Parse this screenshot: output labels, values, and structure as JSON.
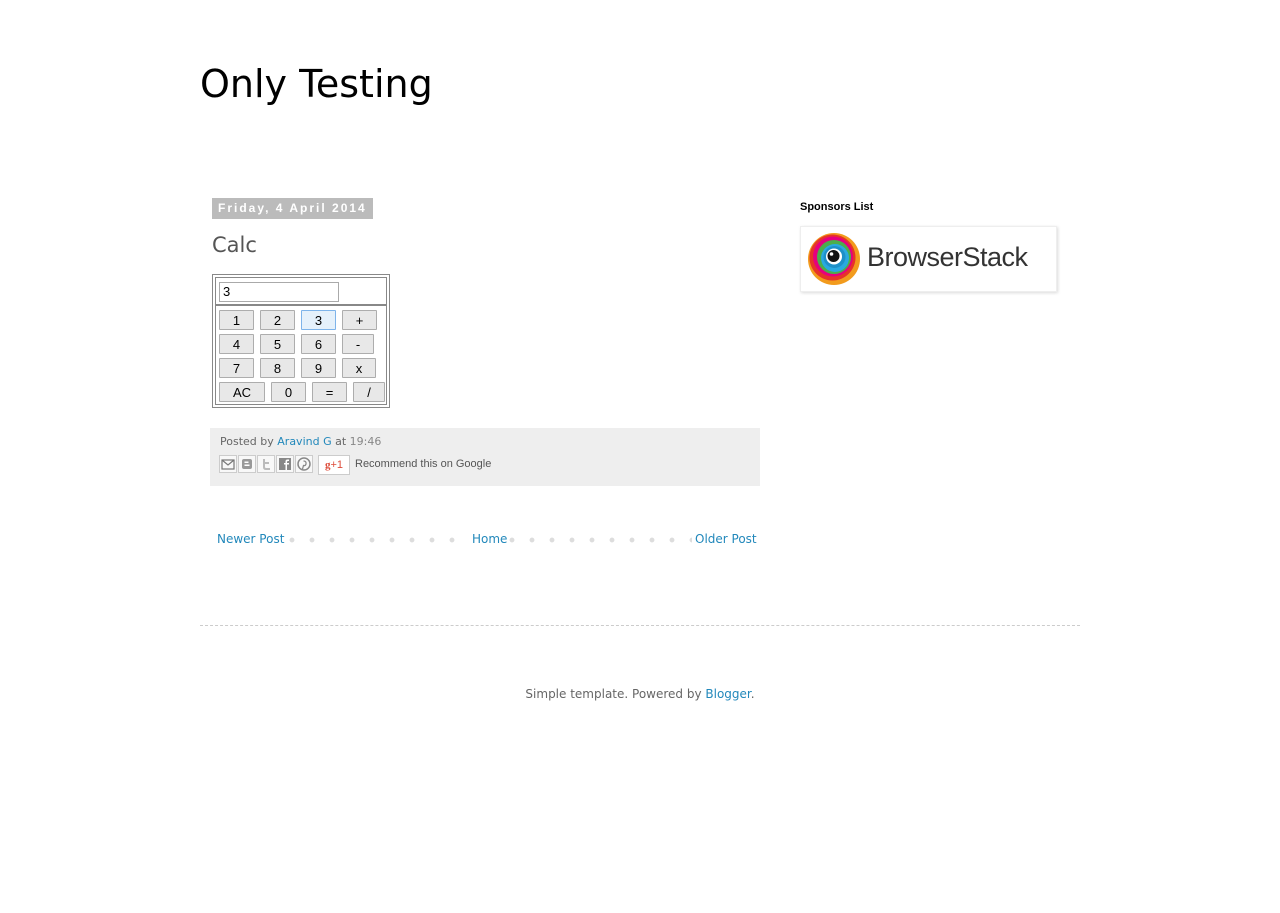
{
  "blog": {
    "title": "Only Testing"
  },
  "post": {
    "date": "Friday, 4 April 2014",
    "title": "Calc",
    "calculator": {
      "display_value": "3",
      "keys": [
        {
          "label": "1"
        },
        {
          "label": "2"
        },
        {
          "label": "3",
          "active": true
        },
        {
          "label": "+"
        },
        {
          "label": "4"
        },
        {
          "label": "5"
        },
        {
          "label": "6"
        },
        {
          "label": "-"
        },
        {
          "label": "7"
        },
        {
          "label": "8"
        },
        {
          "label": "9"
        },
        {
          "label": "x"
        },
        {
          "label": "AC"
        },
        {
          "label": "0"
        },
        {
          "label": "="
        },
        {
          "label": "/"
        }
      ]
    },
    "footer": {
      "posted_by_label": "Posted by",
      "author": "Aravind G",
      "at_label": "at",
      "time": "19:46",
      "share_icons": [
        "email-icon",
        "blogger-icon",
        "twitter-icon",
        "facebook-icon",
        "pinterest-icon"
      ],
      "gplus_label": "+1",
      "recommend_text": "Recommend this on Google"
    }
  },
  "pager": {
    "newer": "Newer Post",
    "home": "Home",
    "older": "Older Post"
  },
  "attribution": {
    "text": "Simple template. Powered by",
    "link": "Blogger",
    "suffix": "."
  },
  "sidebar": {
    "title": "Sponsors List",
    "sponsor": {
      "name": "BrowserStack"
    }
  },
  "colors": {
    "link": "#2288bb",
    "date_header_bg": "#bbbbbb",
    "footer_bg": "#eeeeee"
  }
}
